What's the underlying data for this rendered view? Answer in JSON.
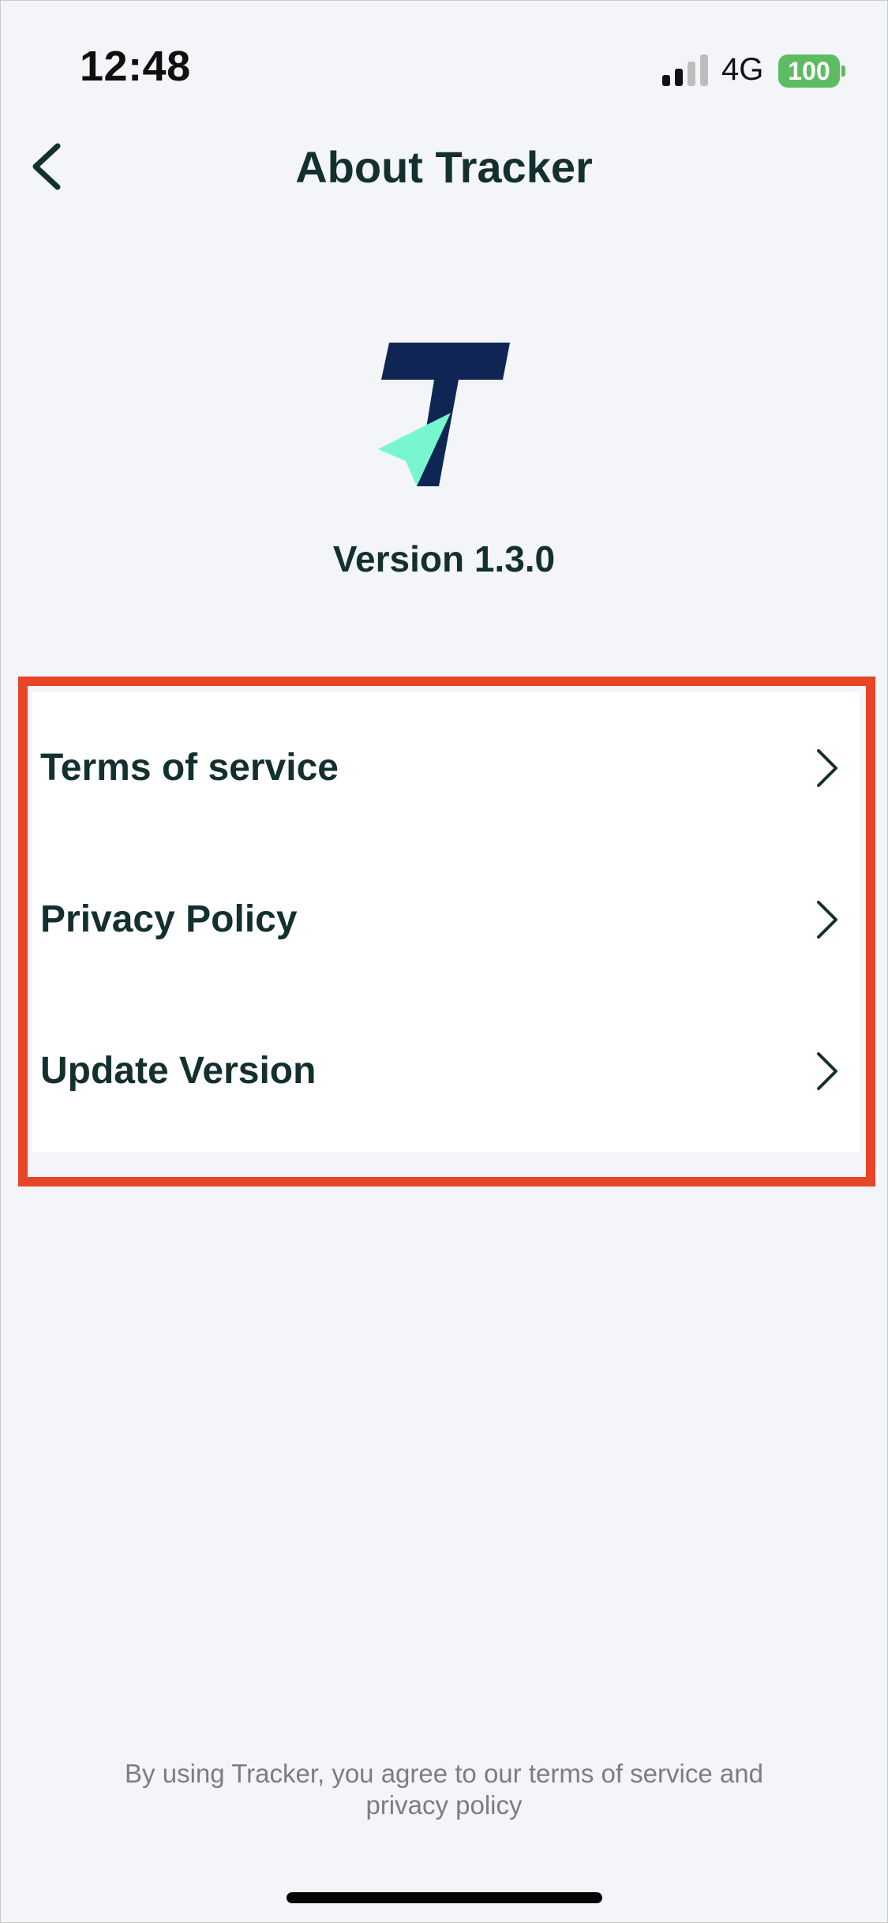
{
  "status_bar": {
    "time": "12:48",
    "network": "4G",
    "battery": "100",
    "signal_icon": "signal-bars-icon",
    "colors": {
      "battery": "#5dbb63"
    }
  },
  "nav": {
    "title": "About Tracker",
    "back_icon": "chevron-left-icon"
  },
  "app": {
    "logo_icon": "tracker-logo-icon",
    "version": "Version 1.3.0",
    "colors": {
      "logo_navy": "#0f2654",
      "logo_mint": "#78f6cf"
    }
  },
  "menu": {
    "highlight_color": "#e84428",
    "items": [
      {
        "label": "Terms of service",
        "icon": "chevron-right-icon"
      },
      {
        "label": "Privacy Policy",
        "icon": "chevron-right-icon"
      },
      {
        "label": "Update Version",
        "icon": "chevron-right-icon"
      }
    ]
  },
  "footer": {
    "line1": "By using Tracker, you agree to our terms of service and",
    "line2": "privacy policy"
  }
}
